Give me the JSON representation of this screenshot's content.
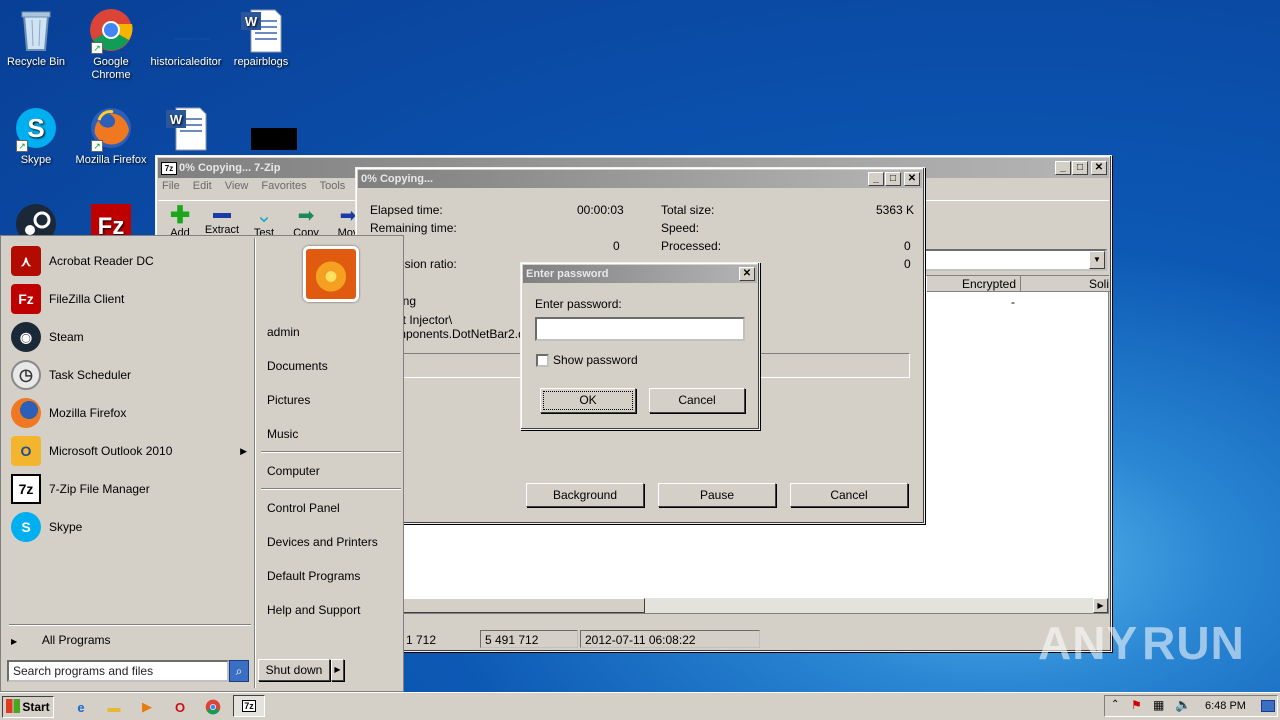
{
  "desktop": {
    "icons": [
      {
        "label": "Recycle Bin",
        "icon": "recycle-bin-icon"
      },
      {
        "label": "Google Chrome",
        "icon": "chrome-icon"
      },
      {
        "label": "historicaleditor",
        "icon": "blank-file-icon"
      },
      {
        "label": "repairblogs",
        "icon": "word-document-icon"
      },
      {
        "label": "Skype",
        "icon": "skype-icon"
      },
      {
        "label": "Mozilla Firefox",
        "icon": "firefox-icon"
      },
      {
        "label": "",
        "icon": "word-document-icon"
      },
      {
        "label": "",
        "icon": "black-file-icon"
      },
      {
        "label": "",
        "icon": "steam-icon"
      },
      {
        "label": "",
        "icon": "filezilla-icon"
      }
    ]
  },
  "zip_window": {
    "title": "0% Copying... 7-Zip",
    "menu": [
      "File",
      "Edit",
      "View",
      "Favorites",
      "Tools",
      "H"
    ],
    "toolbar": [
      "Add",
      "Extract",
      "Test",
      "Copy",
      "Mov"
    ],
    "columns": [
      "Encrypted",
      "Soli"
    ],
    "row_encrypted": "-",
    "status": [
      "1 712",
      "5 491 712",
      "2012-07-11 06:08:22"
    ]
  },
  "progress_dialog": {
    "title": "0% Copying...",
    "elapsed_label": "Elapsed time:",
    "elapsed_value": "00:00:03",
    "remaining_label": "Remaining time:",
    "files_value": "0",
    "ratio_label": "ession ratio:",
    "total_size_label": "Total size:",
    "total_size_value": "5363 K",
    "speed_label": "Speed:",
    "processed_label": "Processed:",
    "processed_value": "0",
    "compressed_value": "0",
    "action_label": "ing",
    "path_line1": "et Injector\\",
    "path_line2": "mponents.DotNetBar2.dl",
    "buttons": {
      "background": "Background",
      "pause": "Pause",
      "cancel": "Cancel"
    }
  },
  "password_dialog": {
    "title": "Enter password",
    "prompt": "Enter password:",
    "value": "",
    "show_password": "Show password",
    "ok": "OK",
    "cancel": "Cancel"
  },
  "start_menu": {
    "programs": [
      {
        "label": "Acrobat Reader DC",
        "icon": "acrobat-icon"
      },
      {
        "label": "FileZilla Client",
        "icon": "filezilla-icon"
      },
      {
        "label": "Steam",
        "icon": "steam-icon"
      },
      {
        "label": "Task Scheduler",
        "icon": "task-scheduler-icon"
      },
      {
        "label": "Mozilla Firefox",
        "icon": "firefox-icon"
      },
      {
        "label": "Microsoft Outlook 2010",
        "icon": "outlook-icon"
      },
      {
        "label": "7-Zip File Manager",
        "icon": "7zip-icon"
      },
      {
        "label": "Skype",
        "icon": "skype-icon"
      }
    ],
    "all_programs": "All Programs",
    "search_placeholder": "Search programs and files",
    "right_items": [
      "admin",
      "Documents",
      "Pictures",
      "Music",
      "Computer",
      "Control Panel",
      "Devices and Printers",
      "Default Programs",
      "Help and Support"
    ],
    "shutdown": "Shut down"
  },
  "taskbar": {
    "start": "Start",
    "clock": "6:48 PM"
  },
  "watermark": "ANY RUN"
}
